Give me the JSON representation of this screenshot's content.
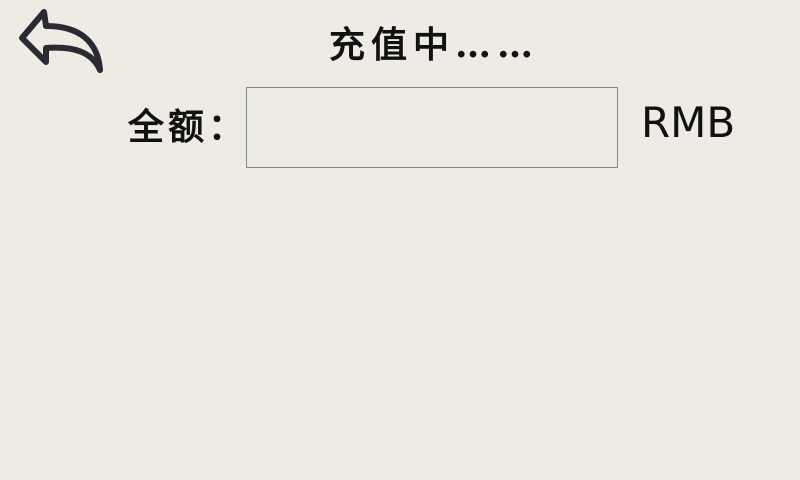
{
  "header": {
    "back_icon": "back-arrow-icon",
    "title": "充值中……"
  },
  "form": {
    "amount_label": "全额：",
    "amount_value": "",
    "amount_placeholder": "",
    "currency_label": "RMB"
  },
  "colors": {
    "background": "#eeebe4",
    "input_border": "#7c8a84",
    "icon_stroke": "#2b2a33"
  }
}
